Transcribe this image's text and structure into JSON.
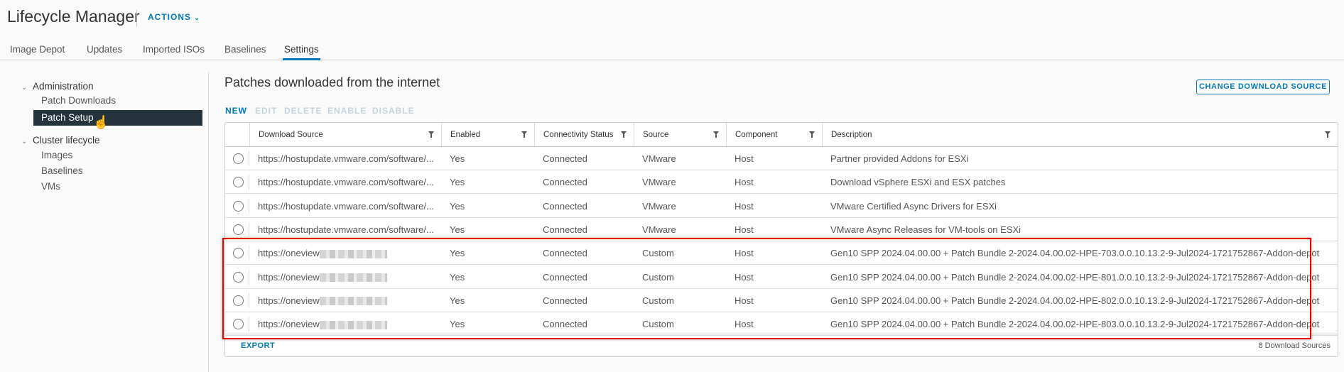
{
  "header": {
    "title": "Lifecycle Manager",
    "actions_label": "ACTIONS"
  },
  "tabs": [
    "Image Depot",
    "Updates",
    "Imported ISOs",
    "Baselines",
    "Settings"
  ],
  "active_tab": "Settings",
  "sidebar": {
    "sections": [
      {
        "label": "Administration",
        "items": [
          "Patch Downloads",
          "Patch Setup"
        ]
      },
      {
        "label": "Cluster lifecycle",
        "items": [
          "Images",
          "Baselines",
          "VMs"
        ]
      }
    ],
    "active_item": "Patch Setup"
  },
  "main": {
    "heading": "Patches downloaded from the internet",
    "change_source_label": "CHANGE DOWNLOAD SOURCE",
    "toolbar": [
      "NEW",
      "EDIT",
      "DELETE",
      "ENABLE",
      "DISABLE"
    ],
    "columns": [
      "Download Source",
      "Enabled",
      "Connectivity Status",
      "Source",
      "Component",
      "Description"
    ],
    "rows": [
      [
        "https://hostupdate.vmware.com/software/...",
        "Yes",
        "Connected",
        "VMware",
        "Host",
        "Partner provided Addons for ESXi"
      ],
      [
        "https://hostupdate.vmware.com/software/...",
        "Yes",
        "Connected",
        "VMware",
        "Host",
        "Download vSphere ESXi and ESX patches"
      ],
      [
        "https://hostupdate.vmware.com/software/...",
        "Yes",
        "Connected",
        "VMware",
        "Host",
        "VMware Certified Async Drivers for ESXi"
      ],
      [
        "https://hostupdate.vmware.com/software/...",
        "Yes",
        "Connected",
        "VMware",
        "Host",
        "VMware Async Releases for VM-tools on ESXi"
      ],
      [
        "https://oneview",
        "Yes",
        "Connected",
        "Custom",
        "Host",
        "Gen10 SPP 2024.04.00.00 + Patch Bundle 2-2024.04.00.02-HPE-703.0.0.10.13.2-9-Jul2024-1721752867-Addon-depot"
      ],
      [
        "https://oneview",
        "Yes",
        "Connected",
        "Custom",
        "Host",
        "Gen10 SPP 2024.04.00.00 + Patch Bundle 2-2024.04.00.02-HPE-801.0.0.10.13.2-9-Jul2024-1721752867-Addon-depot"
      ],
      [
        "https://oneview",
        "Yes",
        "Connected",
        "Custom",
        "Host",
        "Gen10 SPP 2024.04.00.00 + Patch Bundle 2-2024.04.00.02-HPE-802.0.0.10.13.2-9-Jul2024-1721752867-Addon-depot"
      ],
      [
        "https://oneview",
        "Yes",
        "Connected",
        "Custom",
        "Host",
        "Gen10 SPP 2024.04.00.00 + Patch Bundle 2-2024.04.00.02-HPE-803.0.0.10.13.2-9-Jul2024-1721752867-Addon-depot"
      ]
    ],
    "export_label": "EXPORT",
    "count_label": "8 Download Sources"
  },
  "colors": {
    "accent": "#0079b8",
    "highlight": "#e00000",
    "active_nav": "#25333d"
  }
}
